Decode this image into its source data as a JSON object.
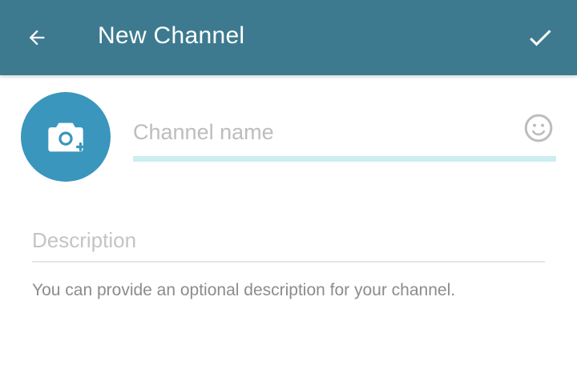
{
  "colors": {
    "toolbar": "#3d7a8f",
    "accent": "#3a96bd",
    "underline_active": "#cdeef0",
    "icon_light": "#ffffff"
  },
  "toolbar": {
    "back_icon": "arrow-back-icon",
    "title": "New Channel",
    "done_icon": "check-icon"
  },
  "avatar": {
    "icon": "camera-add-icon"
  },
  "channel_name": {
    "value": "",
    "placeholder": "Channel name",
    "emoji_icon": "emoji-smile-icon"
  },
  "description": {
    "value": "",
    "placeholder": "Description",
    "hint": "You can provide an optional description for your channel."
  }
}
